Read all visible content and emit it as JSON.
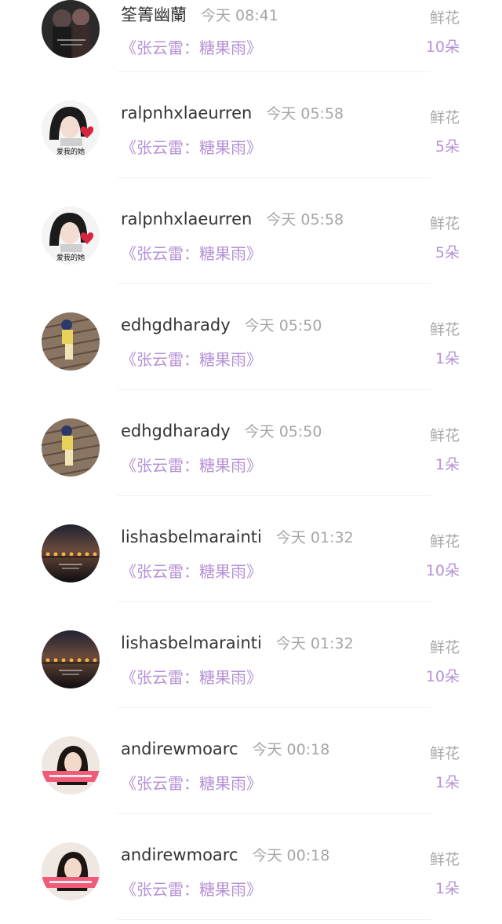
{
  "records": [
    {
      "username": "筌箐幽蘭",
      "time": "今天 08:41",
      "song": "《张云雷：糖果雨》",
      "gift_type": "鲜花",
      "gift_count": "10朵",
      "avatar": "dark-couple"
    },
    {
      "username": "ralpnhxlaeurren",
      "time": "今天 05:58",
      "song": "《张云雷：糖果雨》",
      "gift_type": "鲜花",
      "gift_count": "5朵",
      "avatar": "girl-heart",
      "avatar_caption": "爱我的她"
    },
    {
      "username": "ralpnhxlaeurren",
      "time": "今天 05:58",
      "song": "《张云雷：糖果雨》",
      "gift_type": "鲜花",
      "gift_count": "5朵",
      "avatar": "girl-heart",
      "avatar_caption": "爱我的她"
    },
    {
      "username": "edhgdharady",
      "time": "今天 05:50",
      "song": "《张云雷：糖果雨》",
      "gift_type": "鲜花",
      "gift_count": "1朵",
      "avatar": "boardwalk"
    },
    {
      "username": "edhgdharady",
      "time": "今天 05:50",
      "song": "《张云雷：糖果雨》",
      "gift_type": "鲜花",
      "gift_count": "1朵",
      "avatar": "boardwalk"
    },
    {
      "username": "lishasbelmarainti",
      "time": "今天 01:32",
      "song": "《张云雷：糖果雨》",
      "gift_type": "鲜花",
      "gift_count": "10朵",
      "avatar": "night-bridge"
    },
    {
      "username": "lishasbelmarainti",
      "time": "今天 01:32",
      "song": "《张云雷：糖果雨》",
      "gift_type": "鲜花",
      "gift_count": "10朵",
      "avatar": "night-bridge"
    },
    {
      "username": "andirewmoarc",
      "time": "今天 00:18",
      "song": "《张云雷：糖果雨》",
      "gift_type": "鲜花",
      "gift_count": "1朵",
      "avatar": "woman-banner"
    },
    {
      "username": "andirewmoarc",
      "time": "今天 00:18",
      "song": "《张云雷：糖果雨》",
      "gift_type": "鲜花",
      "gift_count": "1朵",
      "avatar": "woman-banner"
    }
  ],
  "colors": {
    "username": "#333333",
    "time": "#a5a5a5",
    "song": "#b491d6",
    "gift_type": "#a9a9a9",
    "gift_count": "#b491d6",
    "divider": "#f0eff3"
  }
}
